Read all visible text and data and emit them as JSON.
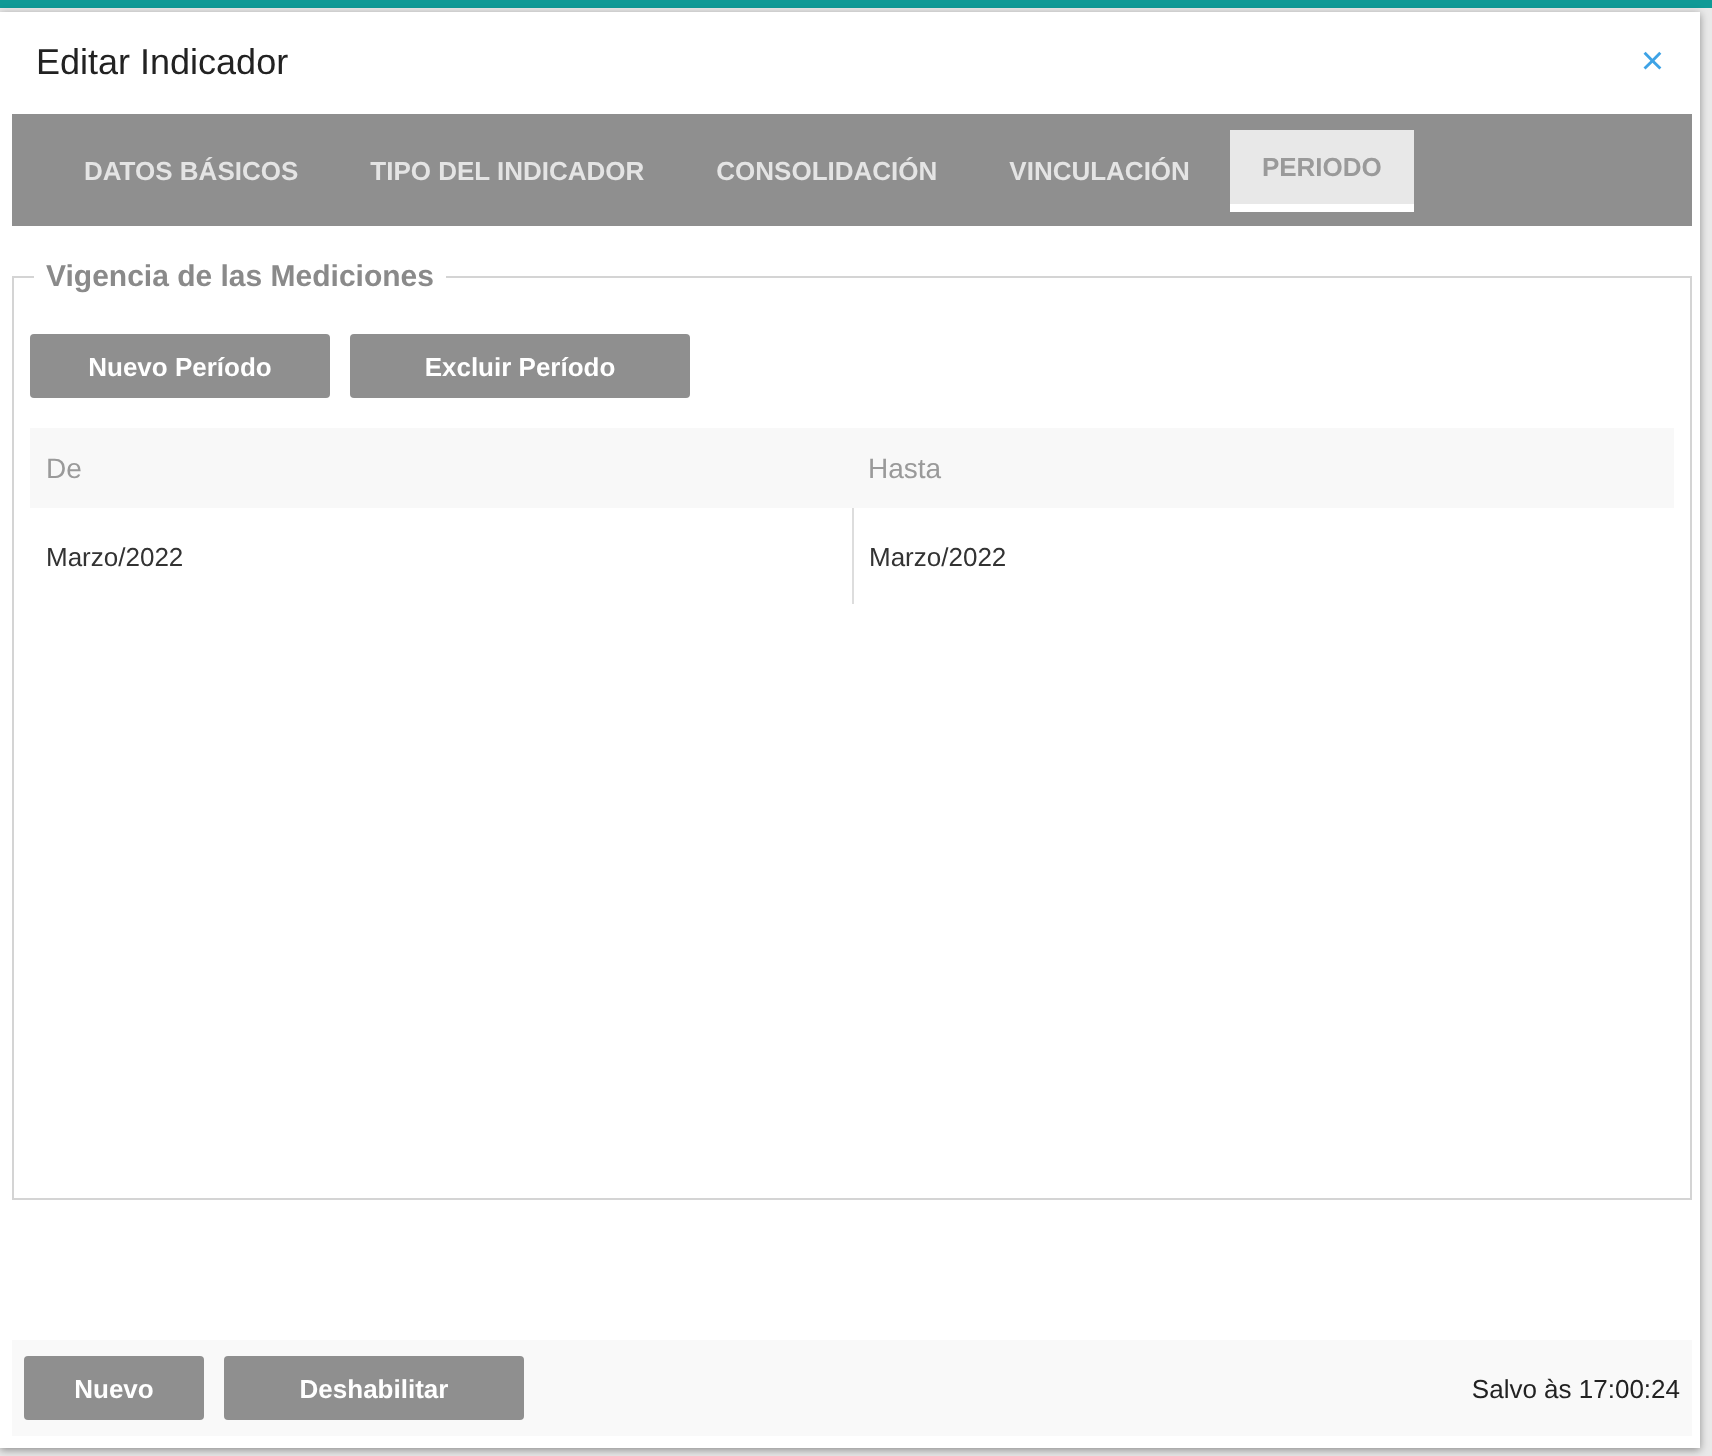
{
  "dialog": {
    "title": "Editar Indicador",
    "close": "×"
  },
  "tabs": [
    {
      "label": "DATOS BÁSICOS",
      "selected": false
    },
    {
      "label": "TIPO DEL INDICADOR",
      "selected": false
    },
    {
      "label": "CONSOLIDACIÓN",
      "selected": false
    },
    {
      "label": "VINCULACIÓN",
      "selected": false
    },
    {
      "label": "PERIODO",
      "selected": true
    }
  ],
  "section": {
    "legend": "Vigencia de las Mediciones",
    "buttons": [
      "Nuevo Período",
      "Excluir Período"
    ],
    "table": {
      "columns": [
        "De",
        "Hasta"
      ],
      "rows": [
        [
          "Marzo/2022",
          "Marzo/2022"
        ]
      ]
    }
  },
  "footer": {
    "buttons": [
      "Nuevo",
      "Deshabilitar"
    ],
    "status": "Salvo às 17:00:24"
  }
}
